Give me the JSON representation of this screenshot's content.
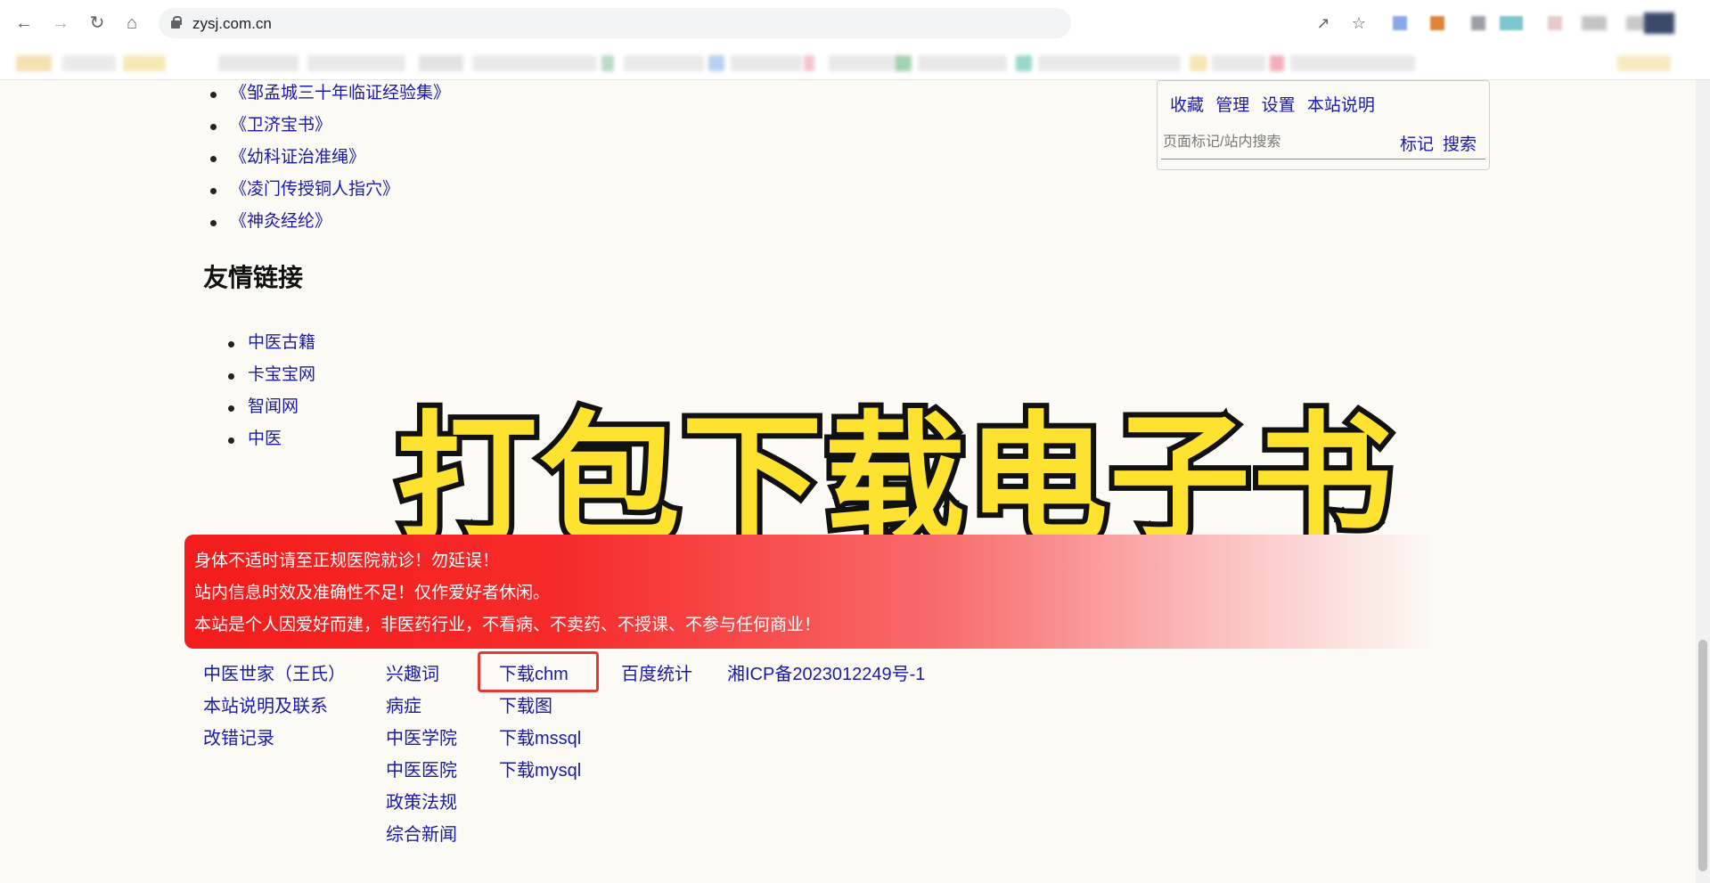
{
  "browser": {
    "url": "zysj.com.cn",
    "nav_icons": [
      "back-icon",
      "forward-icon",
      "reload-icon",
      "home-icon"
    ],
    "omnibox_icons": [
      "share-icon",
      "star-icon"
    ]
  },
  "books": [
    "《邹孟城三十年临证经验集》",
    "《卫济宝书》",
    "《幼科证治准绳》",
    "《凌门传授铜人指穴》",
    "《神灸经纶》"
  ],
  "friends": {
    "heading": "友情链接",
    "items": [
      "中医古籍",
      "卡宝宝网",
      "智闻网",
      "中医"
    ]
  },
  "side_panel": {
    "links": [
      "收藏",
      "管理",
      "设置",
      "本站说明"
    ],
    "search_placeholder": "页面标记/站内搜索",
    "mark_label": "标记",
    "search_label": "搜索"
  },
  "overlay_title": "打包下载电子书",
  "warning": {
    "lines": [
      "身体不适时请至正规医院就诊！勿延误！",
      "站内信息时效及准确性不足！仅作爱好者休闲。",
      "本站是个人因爱好而建，非医药行业，不看病、不卖药、不授课、不参与任何商业！"
    ]
  },
  "footer": {
    "col1": [
      "中医世家（王氏）",
      "本站说明及联系",
      "改错记录"
    ],
    "col2": [
      "兴趣词",
      "病症",
      "中医学院",
      "中医医院",
      "政策法规",
      "综合新闻"
    ],
    "col3": [
      "下载chm",
      "下载图",
      "下载mssql",
      "下载mysql"
    ],
    "col4": [
      "百度统计"
    ],
    "col5": [
      "湘ICP备2023012249号-1"
    ]
  },
  "colors": {
    "link": "#1a1aa6",
    "warning_red": "#f41c1c",
    "overlay_yellow": "#fde330",
    "highlight_red": "#e53935",
    "page_bg": "#fbfaf4"
  }
}
